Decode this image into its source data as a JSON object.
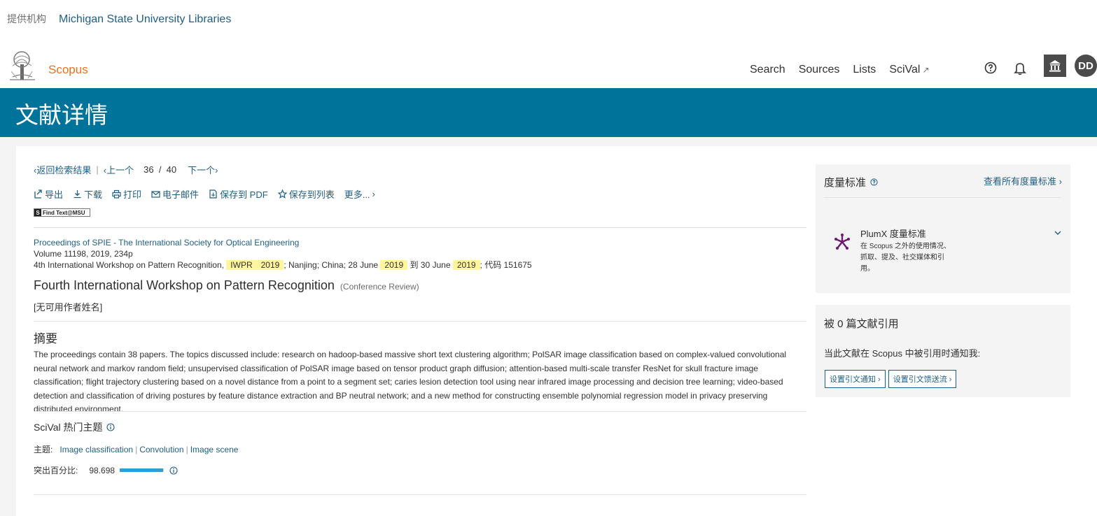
{
  "institution": {
    "label": "提供机构",
    "name": "Michigan State University Libraries"
  },
  "brand": {
    "name": "Scopus"
  },
  "nav": {
    "search": "Search",
    "sources": "Sources",
    "lists": "Lists",
    "scival": "SciVal",
    "scival_ext": "↗"
  },
  "user": {
    "initials": "DD"
  },
  "icons": {
    "help": "help-circle-icon",
    "bell": "bell-icon",
    "institution": "institution-icon"
  },
  "banner": {
    "title": "文献详情"
  },
  "pager": {
    "back": "返回检索结果",
    "sep": "|",
    "prev": "上一个",
    "current": "36",
    "slash": "/",
    "total": "40",
    "next": "下一个"
  },
  "toolbar": {
    "export": "导出",
    "download": "下载",
    "print": "打印",
    "email": "电子邮件",
    "save_pdf": "保存到 PDF",
    "save_list": "保存到列表",
    "more": "更多..."
  },
  "findtext": {
    "s": "S",
    "label": "Find Text@MSU"
  },
  "meta": {
    "source": "Proceedings of SPIE - The International Society for Optical Engineering",
    "volume_line": "Volume 11198, 2019, 234p",
    "conf_prefix": "4th International Workshop on Pattern Recognition, ",
    "hl_iwpr": "IWPR",
    "hl_year": "2019",
    "conf_mid1": "; Nanjing; China; 28 June ",
    "conf_mid2": " 到 30 June ",
    "conf_tail": "; 代码 151675"
  },
  "document": {
    "title": "Fourth International Workshop on Pattern Recognition",
    "type": "(Conference Review)",
    "authors": "[无可用作者姓名]"
  },
  "abstract": {
    "heading": "摘要",
    "text": "The proceedings contain 38 papers. The topics discussed include: research on hadoop-based massive short text clustering algorithm; PolSAR image classification based on complex-valued convolutional neural network and markov random field; unsupervised classification of PolSAR image based on tensor product graph diffusion; attention-based multi-scale transfer ResNet for skull fracture image classification; flight trajectory clustering based on a novel distance from a point to a segment set; caries lesion detection tool using near infrared image processing and decision tree learning; video-based detection and classification of driving postures by feature distance extraction and BP neutral network; and a new method for constructing ensemble polynomial regression model in privacy preserving distributed environment."
  },
  "scival": {
    "heading": "SciVal 热门主题",
    "topic_label": "主题:",
    "topics": [
      "Image classification",
      "Convolution",
      "Image scene"
    ],
    "topic_sep": "|",
    "prominence_label": "突出百分比:",
    "prominence": "98.698",
    "prominence_fraction": 0.98698
  },
  "metrics": {
    "title": "度量标准",
    "view_all": "查看所有度量标准",
    "plumx_title": "PlumX 度量标准",
    "plumx_desc": "在 Scopus 之外的使用情况、抓取、提及、社交媒体和引用。"
  },
  "citations": {
    "title": "被 0 篇文献引用",
    "desc": "当此文献在 Scopus 中被引用时通知我:",
    "alert_btn": "设置引文通知",
    "feed_btn": "设置引文馈送流"
  },
  "colors": {
    "banner": "#00739a",
    "link": "#1f5f84",
    "brand": "#e9711c",
    "highlight": "#fff59d",
    "plumx": "#6e1a6e",
    "bar": "#2c9fd9"
  }
}
